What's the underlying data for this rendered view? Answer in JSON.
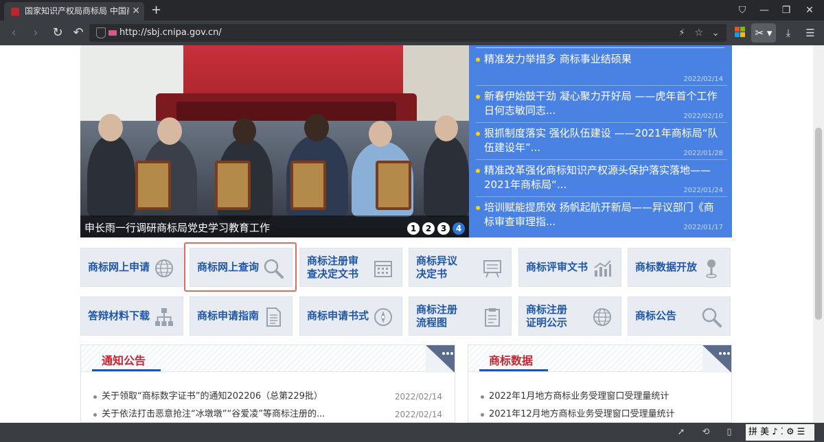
{
  "browser": {
    "tab_title": "国家知识产权局商标局 中国商",
    "url": "http://sbj.cnipa.gov.cn/"
  },
  "carousel": {
    "caption": "申长雨一行调研商标局党史学习教育工作",
    "pages": [
      "1",
      "2",
      "3",
      "4"
    ],
    "active_page": 4
  },
  "news": [
    {
      "title": "精准发力举措多 商标事业结硕果",
      "date": "2022/02/14"
    },
    {
      "title": "新春伊始鼓干劲 凝心聚力开好局 ——虎年首个工作日何志敏同志...",
      "date": "2022/02/10"
    },
    {
      "title": "狠抓制度落实 强化队伍建设 ——2021年商标局“队伍建设年”...",
      "date": "2022/01/28"
    },
    {
      "title": "精准改革强化商标知识产权源头保护落实落地——2021年商标局“...",
      "date": "2022/01/24"
    },
    {
      "title": "培训赋能提质效 扬帆起航开新局——异议部门《商标审查审理指...",
      "date": "2022/01/17"
    }
  ],
  "services": [
    {
      "line1": "商标网上申请",
      "line2": "",
      "icon": "globe-icon"
    },
    {
      "line1": "商标网上查询",
      "line2": "",
      "icon": "magnifier-icon"
    },
    {
      "line1": "商标注册审",
      "line2": "查决定文书",
      "icon": "calendar-icon"
    },
    {
      "line1": "商标异议",
      "line2": "决定书",
      "icon": "easel-icon"
    },
    {
      "line1": "商标评审文书",
      "line2": "",
      "icon": "bar-chart-icon"
    },
    {
      "line1": "商标数据开放",
      "line2": "",
      "icon": "map-pin-icon"
    },
    {
      "line1": "答辩材料下载",
      "line2": "",
      "icon": "org-chart-icon"
    },
    {
      "line1": "商标申请指南",
      "line2": "",
      "icon": "document-icon"
    },
    {
      "line1": "商标申请书式",
      "line2": "",
      "icon": "compass-icon"
    },
    {
      "line1": "商标注册",
      "line2": "流程图",
      "icon": "clipboard-icon"
    },
    {
      "line1": "商标注册",
      "line2": "证明公示",
      "icon": "globe-icon"
    },
    {
      "line1": "商标公告",
      "line2": "",
      "icon": "magnifier-icon"
    }
  ],
  "notices": {
    "title": "通知公告",
    "items": [
      {
        "text": "关于领取“商标数字证书”的通知202206（总第229批）",
        "date": "2022/02/14"
      },
      {
        "text": "关于依法打击恶意抢注“冰墩墩”“谷爱凌”等商标注册的...",
        "date": "2022/02/14"
      }
    ]
  },
  "tm_data": {
    "title": "商标数据",
    "items": [
      {
        "text": "2022年1月地方商标业务受理窗口受理量统计"
      },
      {
        "text": "2021年12月地方商标业务受理窗口受理量统计"
      }
    ]
  },
  "ime": {
    "label": "拼 美 ♪ ⁚ ⚙ ☰"
  }
}
